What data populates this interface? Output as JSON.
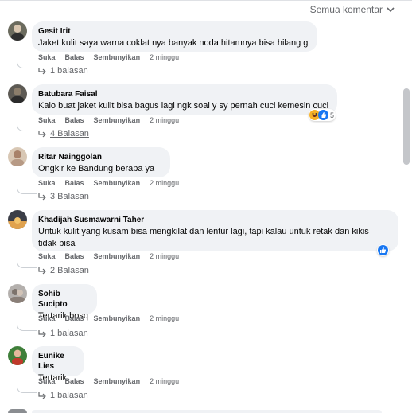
{
  "filter_label": "Semua komentar",
  "actions": {
    "like": "Suka",
    "reply": "Balas",
    "hide": "Sembunyikan"
  },
  "comments": [
    {
      "name": "Gesit Irit",
      "text": "Jaket kulit saya warna coklat nya banyak noda hitamnya bisa hilang g",
      "time": "2 minggu",
      "replies": "1 balasan"
    },
    {
      "name": "Batubara Faisal",
      "text": "Kalo buat jaket kulit bisa bagus lagi ngk soal y sy pernah cuci kemesin cuci",
      "time": "2 minggu",
      "replies": "4 Balasan",
      "reaction_count": "5"
    },
    {
      "name": "Ritar Nainggolan",
      "text": "Ongkir ke Bandung berapa ya",
      "time": "2 minggu",
      "replies": "3 Balasan"
    },
    {
      "name": "Khadijah Susmawarni Taher",
      "text_line1": "Untuk kulit yang kusam bisa mengkilat dan lentur lagi, tapi kalau untuk retak dan kikis",
      "text_line2": "tidak bisa",
      "time": "2 minggu",
      "replies": "2 Balasan"
    },
    {
      "name": "Sohib Sucipto",
      "text": "Tertarik bosq",
      "time": "2 minggu",
      "replies": "1 balasan"
    },
    {
      "name": "Eunike Lies",
      "text": "Tertarik",
      "time": "2 minggu",
      "replies": "1 balasan"
    }
  ]
}
